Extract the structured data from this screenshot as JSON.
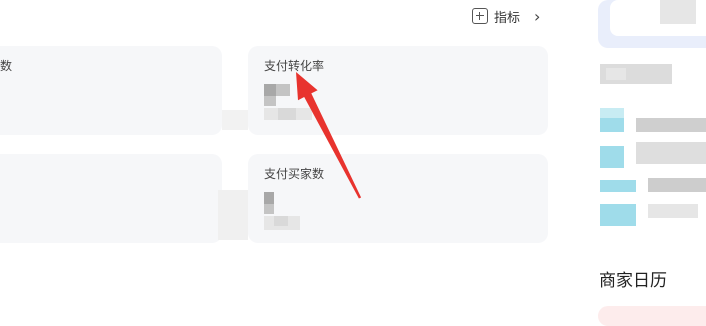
{
  "toolbar": {
    "metrics_label": "指标",
    "add_icon": "plus-square-icon",
    "chevron_icon": "chevron-right-icon"
  },
  "cards": [
    {
      "title": "数"
    },
    {
      "title": "支付转化率"
    },
    {
      "title": ""
    },
    {
      "title": "支付买家数"
    }
  ],
  "sidebar": {
    "calendar_title": "商家日历"
  },
  "annotation": {
    "arrow_color": "#e8332e"
  }
}
